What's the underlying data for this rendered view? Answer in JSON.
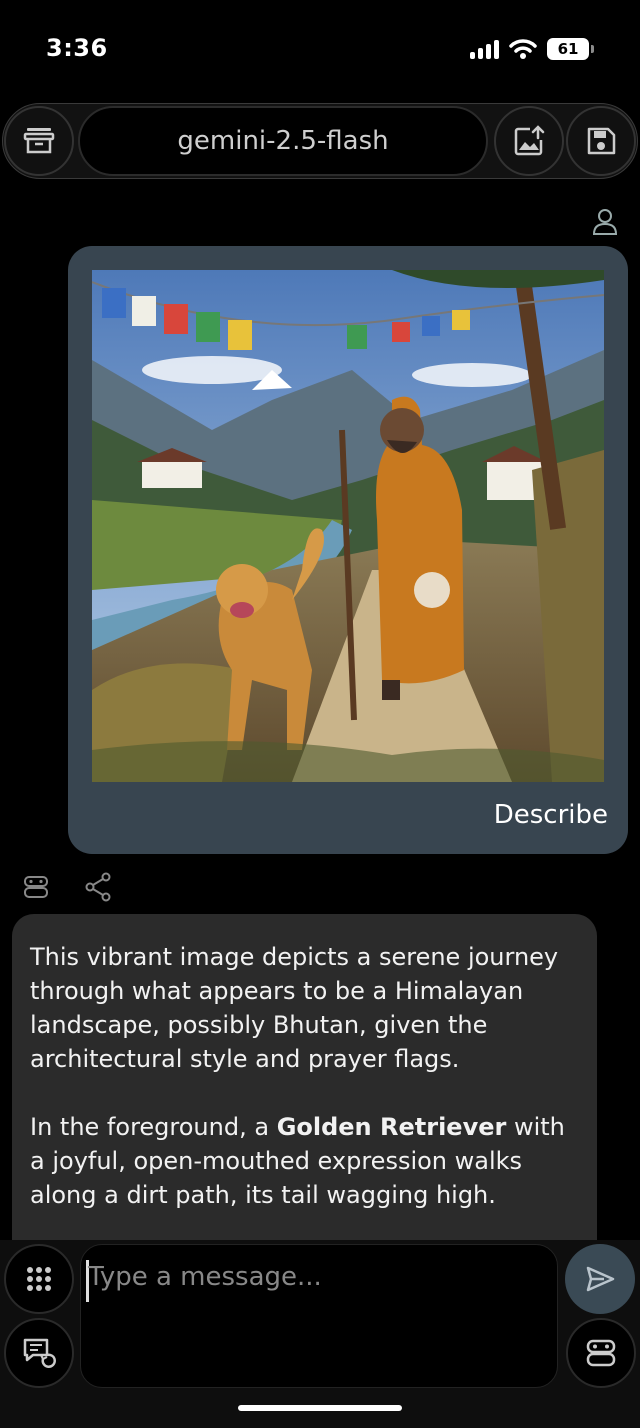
{
  "status": {
    "time": "3:36",
    "battery": "61"
  },
  "header": {
    "model": "gemini-2.5-flash"
  },
  "icons": {
    "archive": "archive-icon",
    "image_upload": "image-upload-icon",
    "save": "save-icon",
    "user": "user-icon",
    "bot": "bot-icon",
    "share": "share-icon",
    "grid": "grid-icon",
    "chat_history": "chat-history-icon",
    "send": "send-icon"
  },
  "user_message": {
    "text": "Describe"
  },
  "bot_message": {
    "paragraph1": "This vibrant image depicts a serene journey through what appears to be a Himalayan landscape, possibly Bhutan, given the architectural style and prayer flags.",
    "p2_before": "In the foreground, a ",
    "p2_bold": "Golden Retriever",
    "p2_after": " with a joyful, open-mouthed expression walks along a dirt path, its tail wagging high."
  },
  "input": {
    "placeholder": "Type a message..."
  },
  "colors": {
    "user_bubble": "#384550",
    "bot_bubble": "#2b2b2b",
    "send_button": "#3a4a55"
  }
}
